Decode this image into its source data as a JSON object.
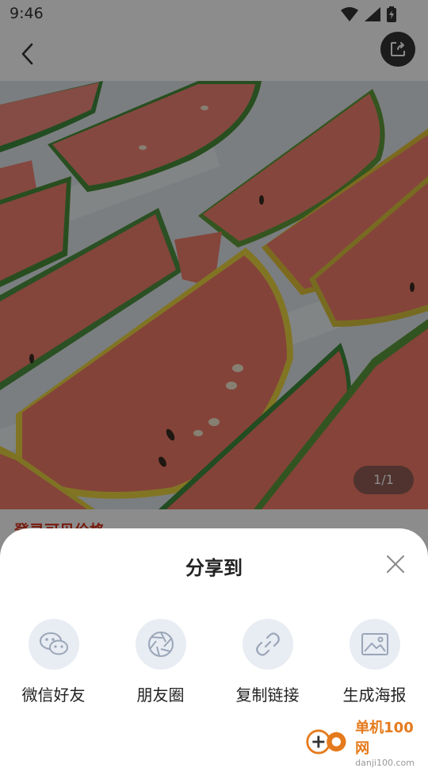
{
  "status_bar": {
    "time": "9:46"
  },
  "nav": {
    "back_icon": "chevron-left-icon",
    "share_icon": "share-icon"
  },
  "product": {
    "image_desc": "watermelon slices",
    "page_indicator": "1/1",
    "price_login_text": "登录可见价格"
  },
  "share_sheet": {
    "title": "分享到",
    "options": [
      {
        "label": "微信好友",
        "icon": "wechat-icon"
      },
      {
        "label": "朋友圈",
        "icon": "moments-icon"
      },
      {
        "label": "复制链接",
        "icon": "link-icon"
      },
      {
        "label": "生成海报",
        "icon": "image-icon"
      }
    ]
  },
  "watermark": {
    "title": "单机100网",
    "url": "danji100.com"
  },
  "colors": {
    "accent_red": "#d9341e",
    "sheet_icon_bg": "#e8ecf3",
    "watermark_orange": "#e57a1c"
  }
}
